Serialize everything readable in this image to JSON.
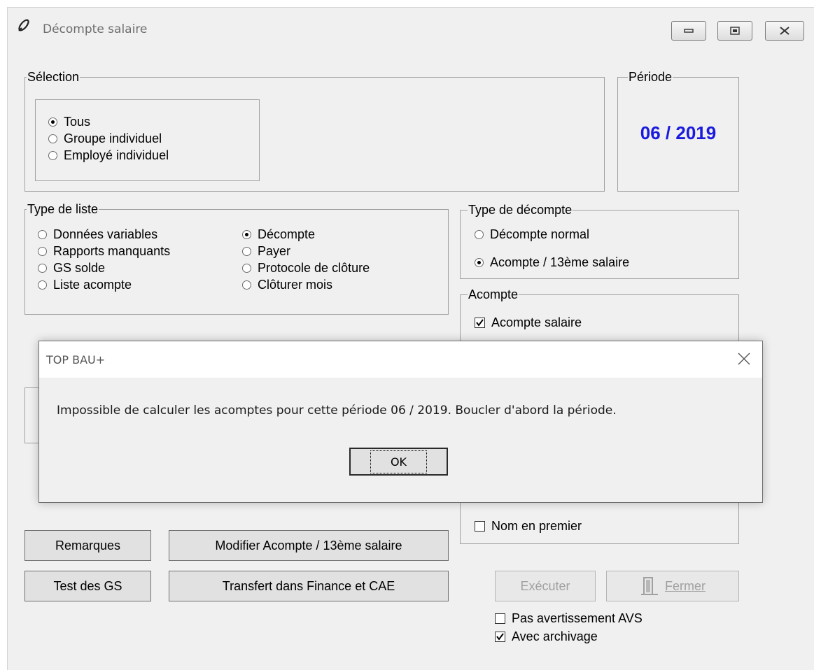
{
  "window": {
    "title": "Décompte salaire"
  },
  "selection": {
    "legend": "Sélection",
    "options": [
      {
        "label": "Tous",
        "selected": true
      },
      {
        "label": "Groupe individuel",
        "selected": false
      },
      {
        "label": "Employé individuel",
        "selected": false
      }
    ]
  },
  "periode": {
    "legend": "Période",
    "value": "06 / 2019",
    "color": "#1a1adf"
  },
  "type_liste": {
    "legend": "Type de liste",
    "left": [
      {
        "label": "Données variables",
        "selected": false
      },
      {
        "label": "Rapports manquants",
        "selected": false
      },
      {
        "label": "GS solde",
        "selected": false
      },
      {
        "label": "Liste acompte",
        "selected": false
      }
    ],
    "right": [
      {
        "label": "Décompte",
        "selected": true
      },
      {
        "label": "Payer",
        "selected": false
      },
      {
        "label": "Protocole de clôture",
        "selected": false
      },
      {
        "label": "Clôturer mois",
        "selected": false
      }
    ]
  },
  "type_decompte": {
    "legend": "Type de décompte",
    "options": [
      {
        "label": "Décompte normal",
        "selected": false
      },
      {
        "label": "Acompte / 13ème salaire",
        "selected": true
      }
    ]
  },
  "acompte": {
    "legend": "Acompte",
    "options": [
      {
        "label": "Acompte salaire",
        "checked": true
      }
    ],
    "nom_en_premier": {
      "label": "Nom en premier",
      "checked": false
    }
  },
  "buttons": {
    "remarques": "Remarques",
    "modifier": "Modifier Acompte / 13ème salaire",
    "test_gs": "Test des GS",
    "transfert": "Transfert dans Finance et CAE",
    "executer": "Exécuter",
    "fermer": "Fermer"
  },
  "bottom_checks": [
    {
      "label": "Pas avertissement AVS",
      "checked": false
    },
    {
      "label": "Avec archivage",
      "checked": true
    }
  ],
  "dialog": {
    "title": "TOP BAU+",
    "message": "Impossible de calculer les acomptes pour cette période 06 / 2019. Boucler d'abord la période.",
    "ok_label": "OK"
  }
}
